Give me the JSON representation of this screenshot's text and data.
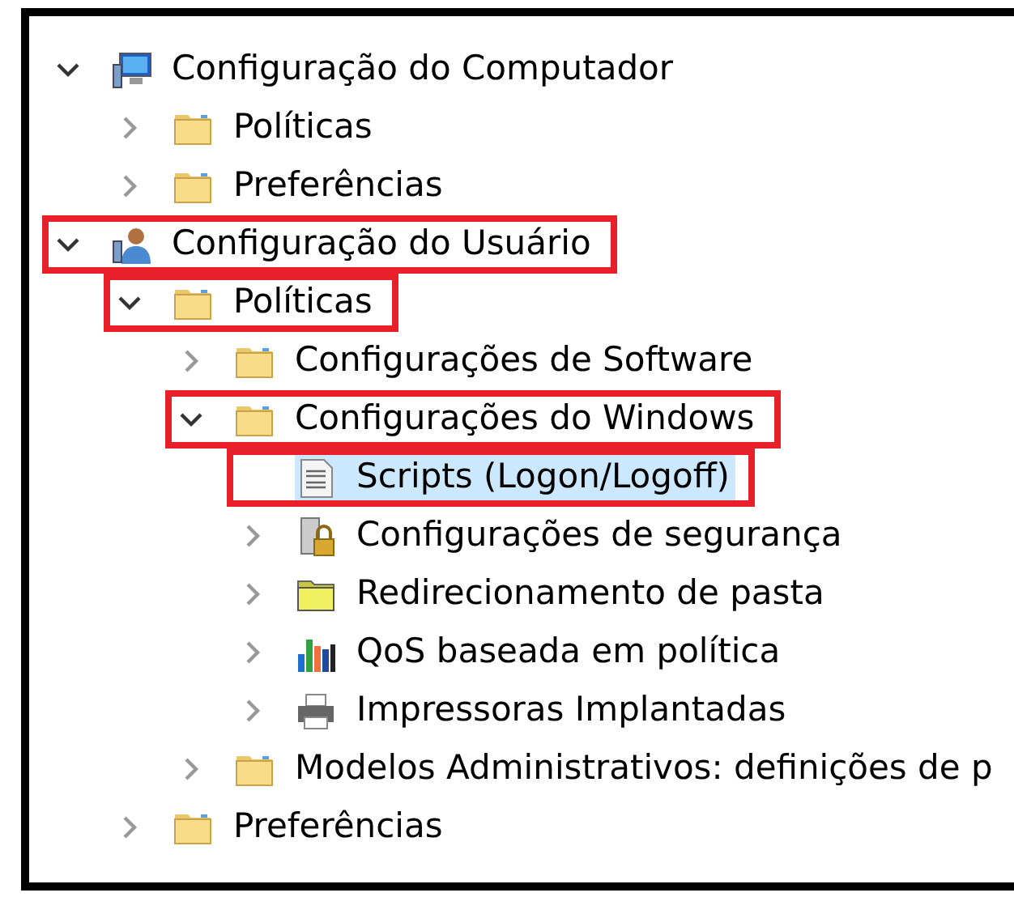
{
  "tree": [
    {
      "label": "Configuração do Computador",
      "kind": "computer",
      "expandable": true,
      "expanded": true,
      "selected": false,
      "highlighted": false,
      "children": [
        {
          "label": "Políticas",
          "kind": "folder",
          "expandable": true,
          "expanded": false,
          "selected": false,
          "highlighted": false
        },
        {
          "label": "Preferências",
          "kind": "folder",
          "expandable": true,
          "expanded": false,
          "selected": false,
          "highlighted": false
        }
      ]
    },
    {
      "label": "Configuração do Usuário",
      "kind": "user",
      "expandable": true,
      "expanded": true,
      "selected": false,
      "highlighted": true,
      "children": [
        {
          "label": "Políticas",
          "kind": "folder",
          "expandable": true,
          "expanded": true,
          "selected": false,
          "highlighted": true,
          "children": [
            {
              "label": "Configurações de Software",
              "kind": "folder",
              "expandable": true,
              "expanded": false,
              "selected": false,
              "highlighted": false
            },
            {
              "label": "Configurações do Windows",
              "kind": "folder",
              "expandable": true,
              "expanded": true,
              "selected": false,
              "highlighted": true,
              "children": [
                {
                  "label": "Scripts (Logon/Logoff)",
                  "kind": "script",
                  "expandable": false,
                  "selected": true,
                  "highlighted": true
                },
                {
                  "label": "Configurações de segurança",
                  "kind": "security",
                  "expandable": true,
                  "expanded": false,
                  "selected": false,
                  "highlighted": false
                },
                {
                  "label": "Redirecionamento de pasta",
                  "kind": "redirect",
                  "expandable": true,
                  "expanded": false,
                  "selected": false,
                  "highlighted": false
                },
                {
                  "label": "QoS baseada em política",
                  "kind": "qos",
                  "expandable": true,
                  "expanded": false,
                  "selected": false,
                  "highlighted": false
                },
                {
                  "label": "Impressoras Implantadas",
                  "kind": "printer",
                  "expandable": true,
                  "expanded": false,
                  "selected": false,
                  "highlighted": false
                }
              ]
            },
            {
              "label": "Modelos Administrativos: definições de p",
              "kind": "folder",
              "expandable": true,
              "expanded": false,
              "selected": false,
              "highlighted": false
            }
          ]
        },
        {
          "label": "Preferências",
          "kind": "folder",
          "expandable": true,
          "expanded": false,
          "selected": false,
          "highlighted": false
        }
      ]
    }
  ]
}
